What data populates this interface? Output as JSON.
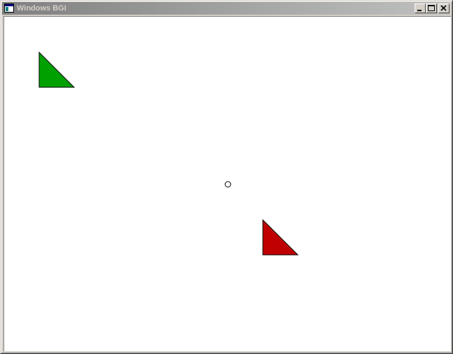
{
  "window": {
    "title": "Windows BGI"
  },
  "icons": {
    "app": "app-window-icon",
    "minimize": "minimize-icon",
    "maximize": "maximize-icon",
    "close": "close-icon"
  },
  "canvas": {
    "background": "#ffffff",
    "shapes": [
      {
        "name": "green-triangle",
        "fill": "#00a000",
        "stroke": "#000000"
      },
      {
        "name": "red-triangle",
        "fill": "#c00000",
        "stroke": "#000000"
      },
      {
        "name": "center-circle",
        "fill": "none",
        "stroke": "#000000"
      }
    ]
  }
}
